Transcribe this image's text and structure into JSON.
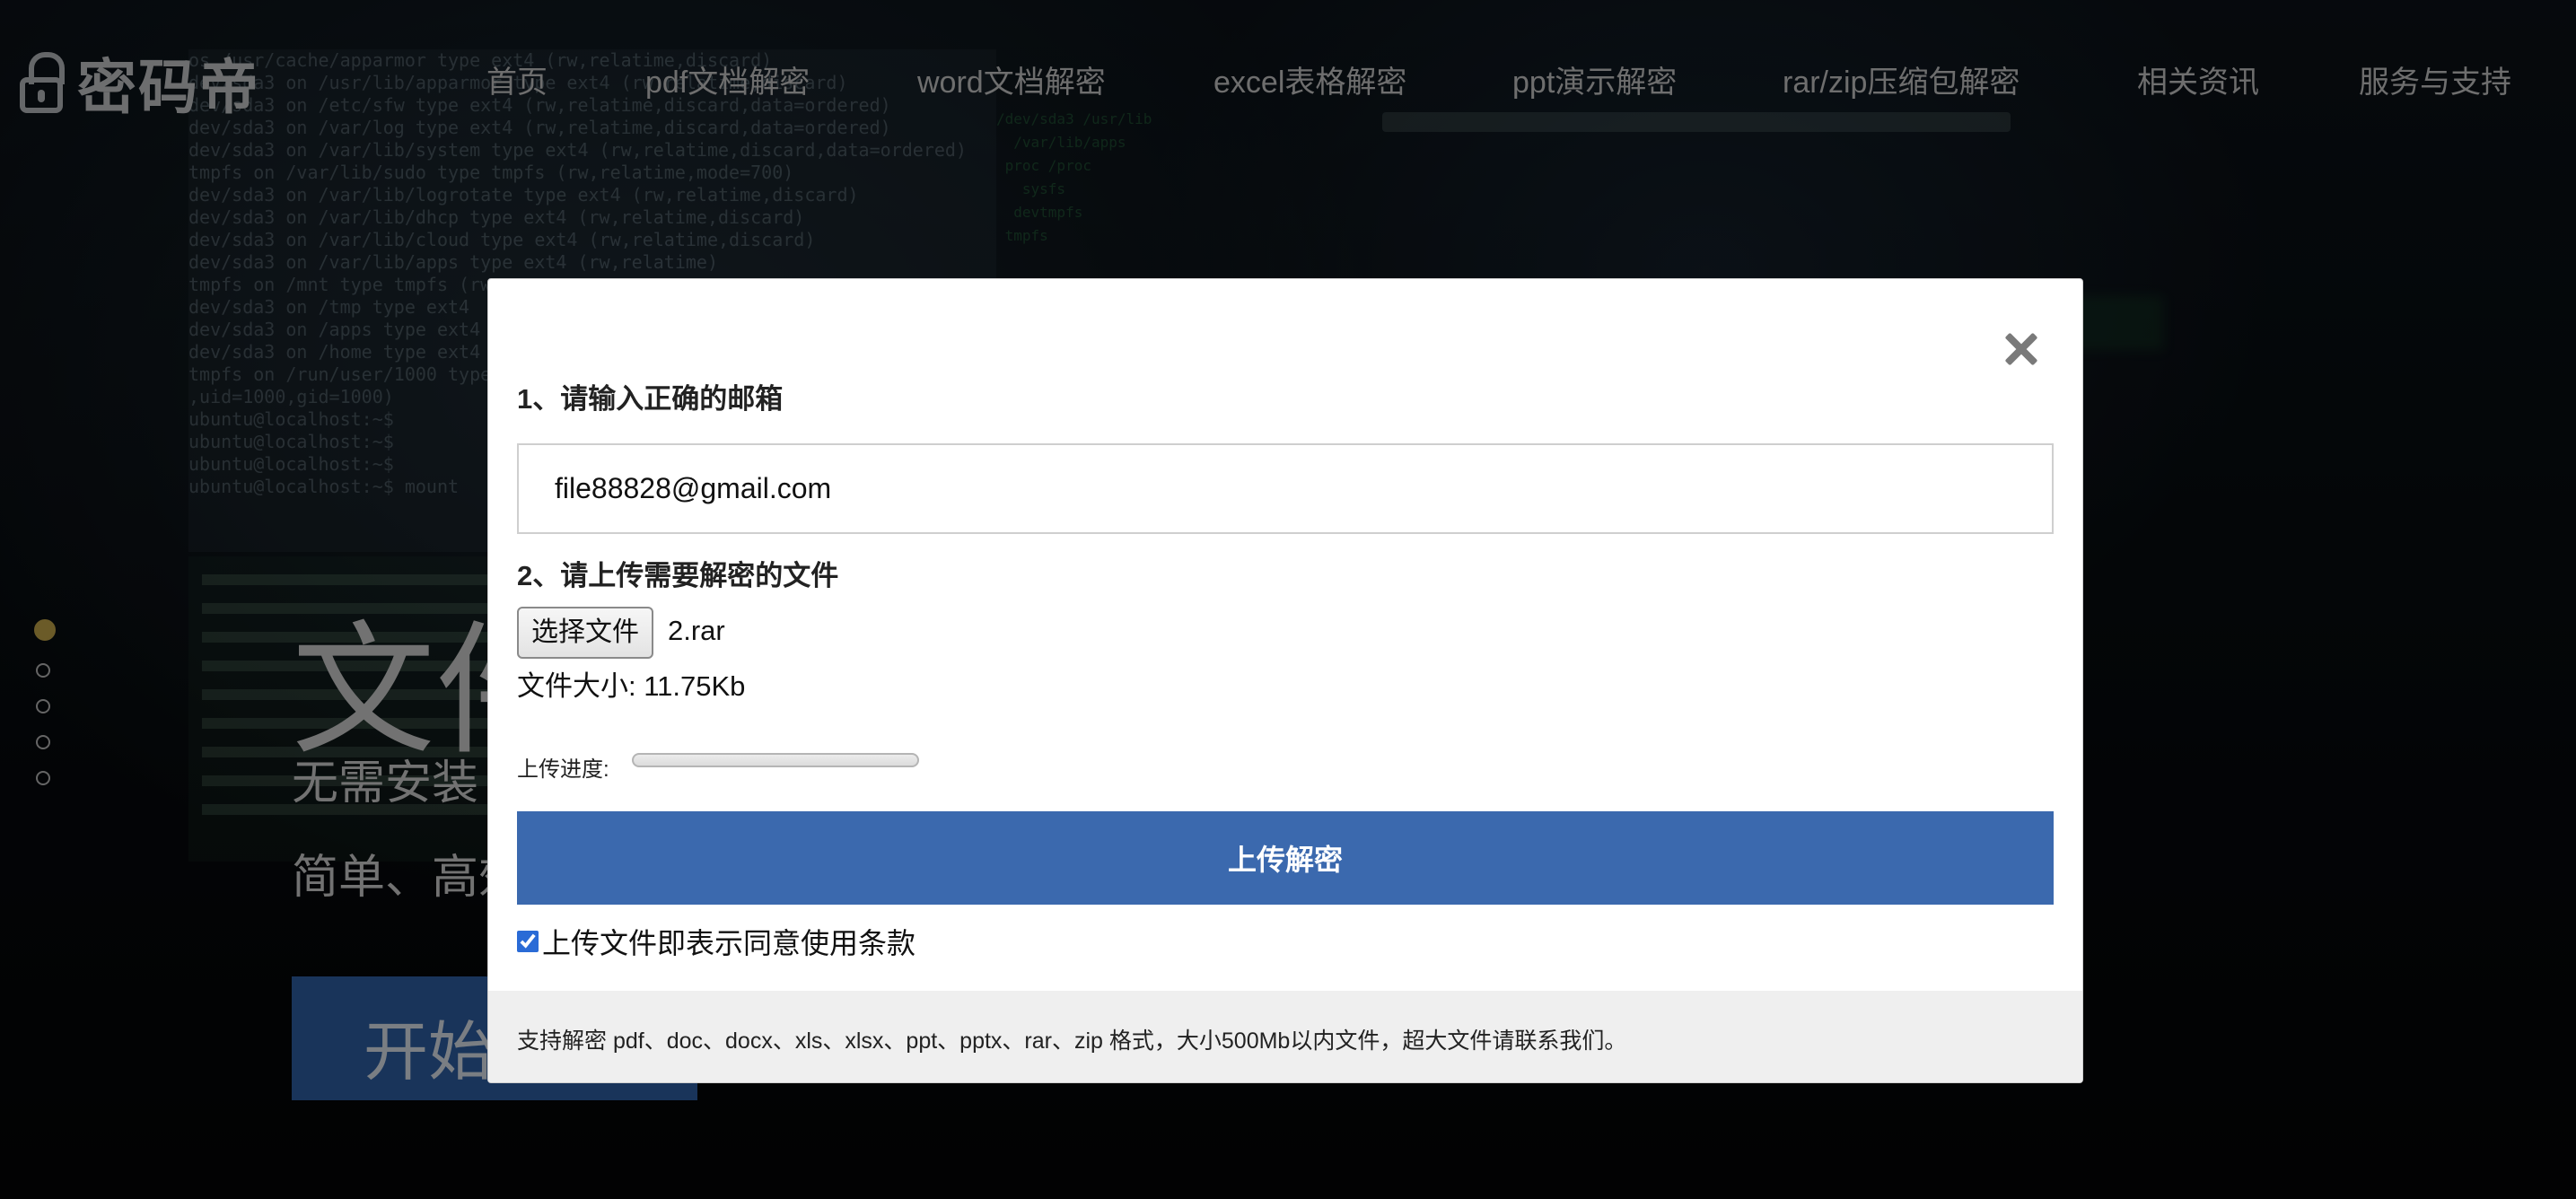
{
  "logo": {
    "text": "密码帝",
    "icon": "lock-icon"
  },
  "nav": [
    {
      "id": "home",
      "label": "首页"
    },
    {
      "id": "pdf",
      "label": "pdf文档解密"
    },
    {
      "id": "word",
      "label": "word文档解密"
    },
    {
      "id": "excel",
      "label": "excel表格解密"
    },
    {
      "id": "ppt",
      "label": "ppt演示解密"
    },
    {
      "id": "rar",
      "label": "rar/zip压缩包解密"
    },
    {
      "id": "news",
      "label": "相关资讯"
    },
    {
      "id": "service",
      "label": "服务与支持"
    }
  ],
  "hero": {
    "title": "文件",
    "subtitle1": "无需安装",
    "subtitle2": "简单、高效",
    "button": "开始解密",
    "slides": 5,
    "active_slide": 1,
    "accent": "#c4a64a"
  },
  "modal": {
    "step1_label": "1、请输入正确的邮箱",
    "email_value": "file88828@gmail.com",
    "step2_label": "2、请上传需要解密的文件",
    "choose_file_label": "选择文件",
    "file_name": "2.rar",
    "file_size_text": "文件大小: 11.75Kb",
    "progress_label": "上传进度:",
    "progress_percent": 0,
    "upload_button": "上传解密",
    "agree_text": "上传文件即表示同意使用条款",
    "agree_checked": true,
    "footer_note": "支持解密 pdf、doc、docx、xls、xlsx、ppt、pptx、rar、zip 格式，大小500Mb以内文件，超大文件请联系我们。",
    "close_icon": "close-icon",
    "button_color": "#3b69ae"
  }
}
